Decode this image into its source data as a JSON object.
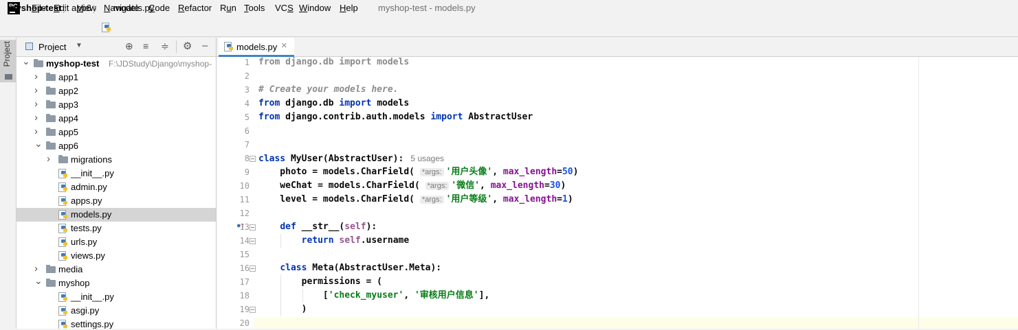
{
  "app": {
    "logo": "PC",
    "window_title": "myshop-test - models.py"
  },
  "menu": [
    {
      "pre": "",
      "u": "F",
      "post": "ile"
    },
    {
      "pre": "",
      "u": "E",
      "post": "dit"
    },
    {
      "pre": "",
      "u": "V",
      "post": "iew"
    },
    {
      "pre": "",
      "u": "N",
      "post": "avigate"
    },
    {
      "pre": "",
      "u": "C",
      "post": "ode"
    },
    {
      "pre": "",
      "u": "R",
      "post": "efactor"
    },
    {
      "pre": "R",
      "u": "u",
      "post": "n"
    },
    {
      "pre": "",
      "u": "T",
      "post": "ools"
    },
    {
      "pre": "VC",
      "u": "S",
      "post": ""
    },
    {
      "pre": "",
      "u": "W",
      "post": "indow"
    },
    {
      "pre": "",
      "u": "H",
      "post": "elp"
    }
  ],
  "breadcrumb": {
    "project": "myshop-test",
    "folder": "app6",
    "file": "models.py"
  },
  "sidebar": {
    "stripe_label": "Project",
    "panel_title": "Project"
  },
  "tree": [
    {
      "label": "myshop-test",
      "path": "F:\\JDStudy\\Django\\myshop-",
      "type": "folder",
      "depth": 0,
      "expanded": true,
      "bold": true
    },
    {
      "label": "app1",
      "type": "folder",
      "depth": 1,
      "expanded": false
    },
    {
      "label": "app2",
      "type": "folder",
      "depth": 1,
      "expanded": false
    },
    {
      "label": "app3",
      "type": "folder",
      "depth": 1,
      "expanded": false
    },
    {
      "label": "app4",
      "type": "folder",
      "depth": 1,
      "expanded": false
    },
    {
      "label": "app5",
      "type": "folder",
      "depth": 1,
      "expanded": false
    },
    {
      "label": "app6",
      "type": "folder",
      "depth": 1,
      "expanded": true
    },
    {
      "label": "migrations",
      "type": "folder",
      "depth": 2,
      "expanded": false
    },
    {
      "label": "__init__.py",
      "type": "py",
      "depth": 2
    },
    {
      "label": "admin.py",
      "type": "py",
      "depth": 2
    },
    {
      "label": "apps.py",
      "type": "py",
      "depth": 2
    },
    {
      "label": "models.py",
      "type": "py",
      "depth": 2,
      "selected": true
    },
    {
      "label": "tests.py",
      "type": "py",
      "depth": 2
    },
    {
      "label": "urls.py",
      "type": "py",
      "depth": 2
    },
    {
      "label": "views.py",
      "type": "py",
      "depth": 2
    },
    {
      "label": "media",
      "type": "folder",
      "depth": 1,
      "expanded": false
    },
    {
      "label": "myshop",
      "type": "folder",
      "depth": 1,
      "expanded": true
    },
    {
      "label": "__init__.py",
      "type": "py",
      "depth": 2
    },
    {
      "label": "asgi.py",
      "type": "py",
      "depth": 2
    },
    {
      "label": "settings.py",
      "type": "py",
      "depth": 2
    }
  ],
  "editor_tab": {
    "label": "models.py",
    "close": "×"
  },
  "code_lines": [
    [
      {
        "t": "from django.db import models",
        "c": "dim"
      }
    ],
    [],
    [
      {
        "t": "# Create your models here.",
        "c": "cm"
      }
    ],
    [
      {
        "t": "from",
        "c": "kw"
      },
      {
        "t": " django.db "
      },
      {
        "t": "import",
        "c": "kw"
      },
      {
        "t": " models"
      }
    ],
    [
      {
        "t": "from",
        "c": "kw"
      },
      {
        "t": " django.contrib.auth.models "
      },
      {
        "t": "import",
        "c": "kw"
      },
      {
        "t": " AbstractUser"
      }
    ],
    [],
    [],
    [
      {
        "t": "class",
        "c": "kw"
      },
      {
        "t": " MyUser(AbstractUser):"
      },
      {
        "t": "5 usages",
        "c": "usages"
      }
    ],
    [
      {
        "t": "    photo = models.CharField( "
      },
      {
        "t": "*args:",
        "c": "hint"
      },
      {
        "t": "'用户头像'",
        "c": "st"
      },
      {
        "t": ", "
      },
      {
        "t": "max_length",
        "c": "kwa"
      },
      {
        "t": "="
      },
      {
        "t": "50",
        "c": "nu"
      },
      {
        "t": ")"
      }
    ],
    [
      {
        "t": "    weChat = models.CharField( "
      },
      {
        "t": "*args:",
        "c": "hint"
      },
      {
        "t": "'微信'",
        "c": "st"
      },
      {
        "t": ", "
      },
      {
        "t": "max_length",
        "c": "kwa"
      },
      {
        "t": "="
      },
      {
        "t": "30",
        "c": "nu"
      },
      {
        "t": ")"
      }
    ],
    [
      {
        "t": "    level = models.CharField( "
      },
      {
        "t": "*args:",
        "c": "hint"
      },
      {
        "t": "'用户等级'",
        "c": "st"
      },
      {
        "t": ", "
      },
      {
        "t": "max_length",
        "c": "kwa"
      },
      {
        "t": "="
      },
      {
        "t": "1",
        "c": "nu"
      },
      {
        "t": ")"
      }
    ],
    [],
    [
      {
        "t": "    "
      },
      {
        "t": "def",
        "c": "kw"
      },
      {
        "t": " __str__("
      },
      {
        "t": "self",
        "c": "self"
      },
      {
        "t": "):"
      }
    ],
    [
      {
        "t": "        "
      },
      {
        "t": "return",
        "c": "kw"
      },
      {
        "t": " "
      },
      {
        "t": "self",
        "c": "self"
      },
      {
        "t": ".username"
      }
    ],
    [],
    [
      {
        "t": "    "
      },
      {
        "t": "class",
        "c": "kw"
      },
      {
        "t": " Meta(AbstractUser.Meta):"
      }
    ],
    [
      {
        "t": "        permissions = ("
      }
    ],
    [
      {
        "t": "            ["
      },
      {
        "t": "'check_myuser'",
        "c": "st"
      },
      {
        "t": ", "
      },
      {
        "t": "'审核用户信息'",
        "c": "st"
      },
      {
        "t": "],"
      }
    ],
    [
      {
        "t": "        )"
      }
    ],
    []
  ],
  "colors": {
    "keyword": "#0033b3",
    "string": "#067d17",
    "number": "#1750eb",
    "kwarg": "#871094",
    "self": "#94558d",
    "comment": "#8c8c8c",
    "accent": "#4083c9"
  }
}
